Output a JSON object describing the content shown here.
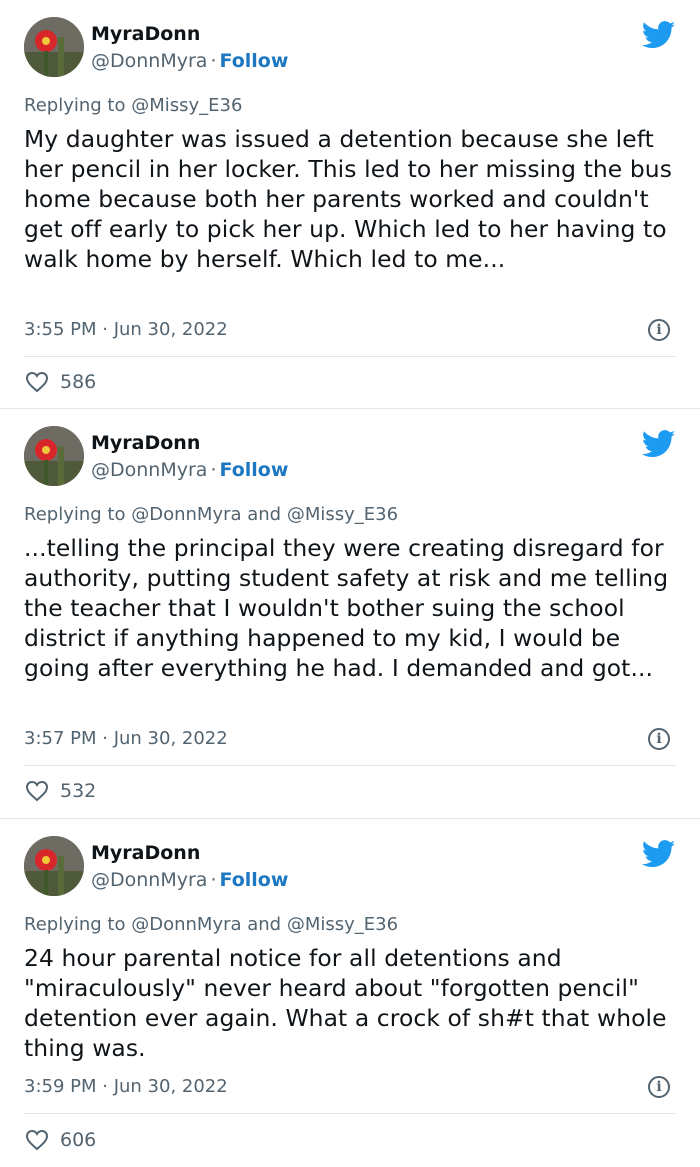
{
  "tweets": [
    {
      "display_name": "MyraDonn",
      "handle": "@DonnMyra",
      "follow_label": "Follow",
      "reply_prefix": "Replying to",
      "reply_to": "@Missy_E36",
      "text": "My daughter was issued a detention because she left her pencil in her locker. This led to her missing the bus home because both her parents worked and couldn't get off early to pick her up. Which led to her having to walk home by herself. Which led to me...",
      "timestamp": "3:55 PM · Jun 30, 2022",
      "likes": "586"
    },
    {
      "display_name": "MyraDonn",
      "handle": "@DonnMyra",
      "follow_label": "Follow",
      "reply_prefix": "Replying to",
      "reply_to": "@DonnMyra and @Missy_E36",
      "text": "...telling the principal they were creating disregard for authority, putting student safety at risk and me telling the teacher that I wouldn't bother suing the school district if anything happened to my kid, I would be going after everything he had. I demanded and got...",
      "timestamp": "3:57 PM · Jun 30, 2022",
      "likes": "532"
    },
    {
      "display_name": "MyraDonn",
      "handle": "@DonnMyra",
      "follow_label": "Follow",
      "reply_prefix": "Replying to",
      "reply_to": "@DonnMyra and @Missy_E36",
      "text": "24 hour parental notice for all detentions and \"miraculously\" never heard about \"forgotten pencil\" detention ever again. What a crock of sh#t that whole thing was.",
      "timestamp": "3:59 PM · Jun 30, 2022",
      "likes": "606"
    }
  ],
  "icons": {
    "brand": "twitter-bird-icon",
    "info": "info-icon",
    "like": "heart-icon"
  },
  "colors": {
    "twitter_blue": "#1d9bf0",
    "follow_blue": "#1d78c1",
    "secondary_text": "#536471"
  }
}
